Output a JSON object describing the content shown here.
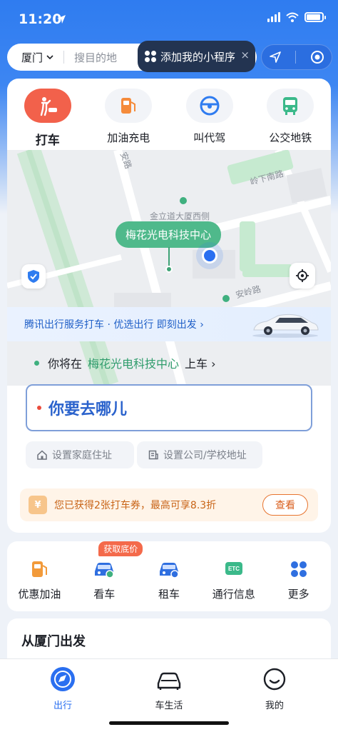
{
  "status_bar": {
    "time": "11:20"
  },
  "search": {
    "city": "厦门",
    "placeholder": "搜目的地"
  },
  "mini_program_tip": {
    "label": "添加我的小程序",
    "close": "×"
  },
  "service_tabs": [
    {
      "label": "打车",
      "icon": "taxi-hail-icon",
      "active": true
    },
    {
      "label": "加油充电",
      "icon": "fuel-pump-icon",
      "active": false
    },
    {
      "label": "叫代驾",
      "icon": "steering-wheel-icon",
      "active": false
    },
    {
      "label": "公交地铁",
      "icon": "bus-icon",
      "active": false
    }
  ],
  "map": {
    "pickup_label": "梅花光电科技中心",
    "road_labels": [
      "安路",
      "岭下南路",
      "金立道大厦西侧",
      "安岭路"
    ]
  },
  "promo": {
    "text": "腾讯出行服务打车 · 优选出行 即刻出发 ›"
  },
  "pickup": {
    "prefix": "你将在",
    "place": "梅花光电科技中心",
    "suffix": "上车 ›"
  },
  "destination": {
    "placeholder": "你要去哪儿"
  },
  "quick_addresses": [
    {
      "label": "设置家庭住址",
      "icon": "home-icon"
    },
    {
      "label": "设置公司/学校地址",
      "icon": "building-icon"
    }
  ],
  "coupon": {
    "text": "您已获得2张打车券，最高可享8.3折",
    "button": "查看",
    "icon_glyph": "¥"
  },
  "services": [
    {
      "label": "优惠加油",
      "icon": "fuel-discount-icon"
    },
    {
      "label": "看车",
      "icon": "car-view-icon",
      "badge": "获取底价"
    },
    {
      "label": "租车",
      "icon": "car-rent-icon"
    },
    {
      "label": "通行信息",
      "icon": "etc-icon"
    },
    {
      "label": "更多",
      "icon": "more-grid-icon"
    }
  ],
  "departure": {
    "title": "从厦门出发"
  },
  "tab_bar": [
    {
      "label": "出行",
      "icon": "compass-icon",
      "active": true
    },
    {
      "label": "车生活",
      "icon": "car-icon",
      "active": false
    },
    {
      "label": "我的",
      "icon": "smile-icon",
      "active": false
    }
  ],
  "colors": {
    "brand_blue": "#2a6ff0",
    "accent_red": "#f2614b",
    "green": "#3fb07f",
    "orange": "#e7742f"
  }
}
